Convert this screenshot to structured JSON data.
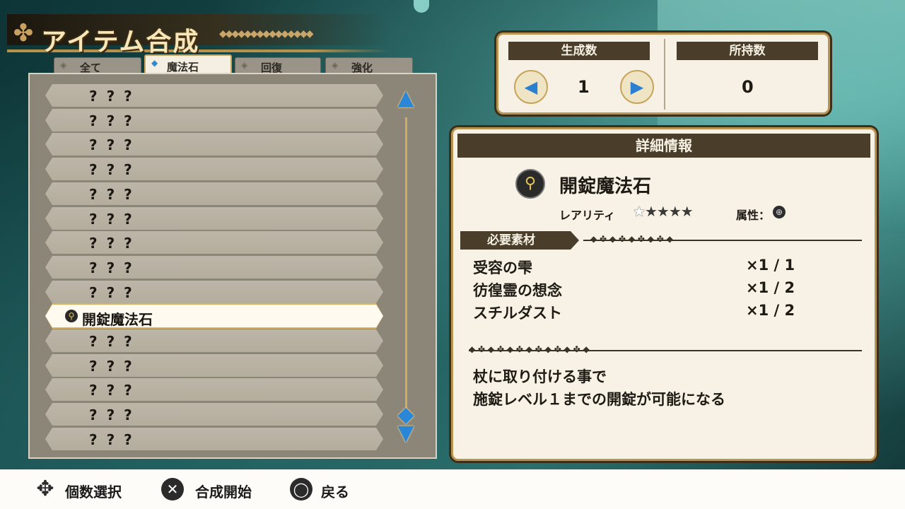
{
  "title": "アイテム合成",
  "tabs": [
    {
      "label": "全て",
      "active": false
    },
    {
      "label": "魔法石",
      "active": true
    },
    {
      "label": "回復",
      "active": false
    },
    {
      "label": "強化",
      "active": false
    }
  ],
  "list": {
    "unknown_label": "? ? ?",
    "selected_index": 9,
    "selected_label": "開錠魔法石",
    "rows": [
      "? ? ?",
      "? ? ?",
      "? ? ?",
      "? ? ?",
      "? ? ?",
      "? ? ?",
      "? ? ?",
      "? ? ?",
      "? ? ?",
      "開錠魔法石",
      "? ? ?",
      "? ? ?",
      "? ? ?",
      "? ? ?",
      "? ? ?"
    ]
  },
  "count": {
    "create_label": "生成数",
    "create_value": "1",
    "owned_label": "所持数",
    "owned_value": "0"
  },
  "detail": {
    "header": "詳細情報",
    "item_name": "開錠魔法石",
    "rarity_label": "レアリティ",
    "rarity_stars": 5,
    "rarity_filled": 4,
    "attribute_label": "属性：",
    "materials_label": "必要素材",
    "materials": [
      {
        "name": "受容の雫",
        "qty": "×1 / 1"
      },
      {
        "name": "彷徨霊の想念",
        "qty": "×1 / 2"
      },
      {
        "name": "スチルダスト",
        "qty": "×1 / 2"
      }
    ],
    "description": [
      "杖に取り付ける事で",
      "施錠レベル１までの開錠が可能になる"
    ]
  },
  "footer": {
    "select_count": "個数選択",
    "start_synthesis": "合成開始",
    "back": "戻る"
  }
}
